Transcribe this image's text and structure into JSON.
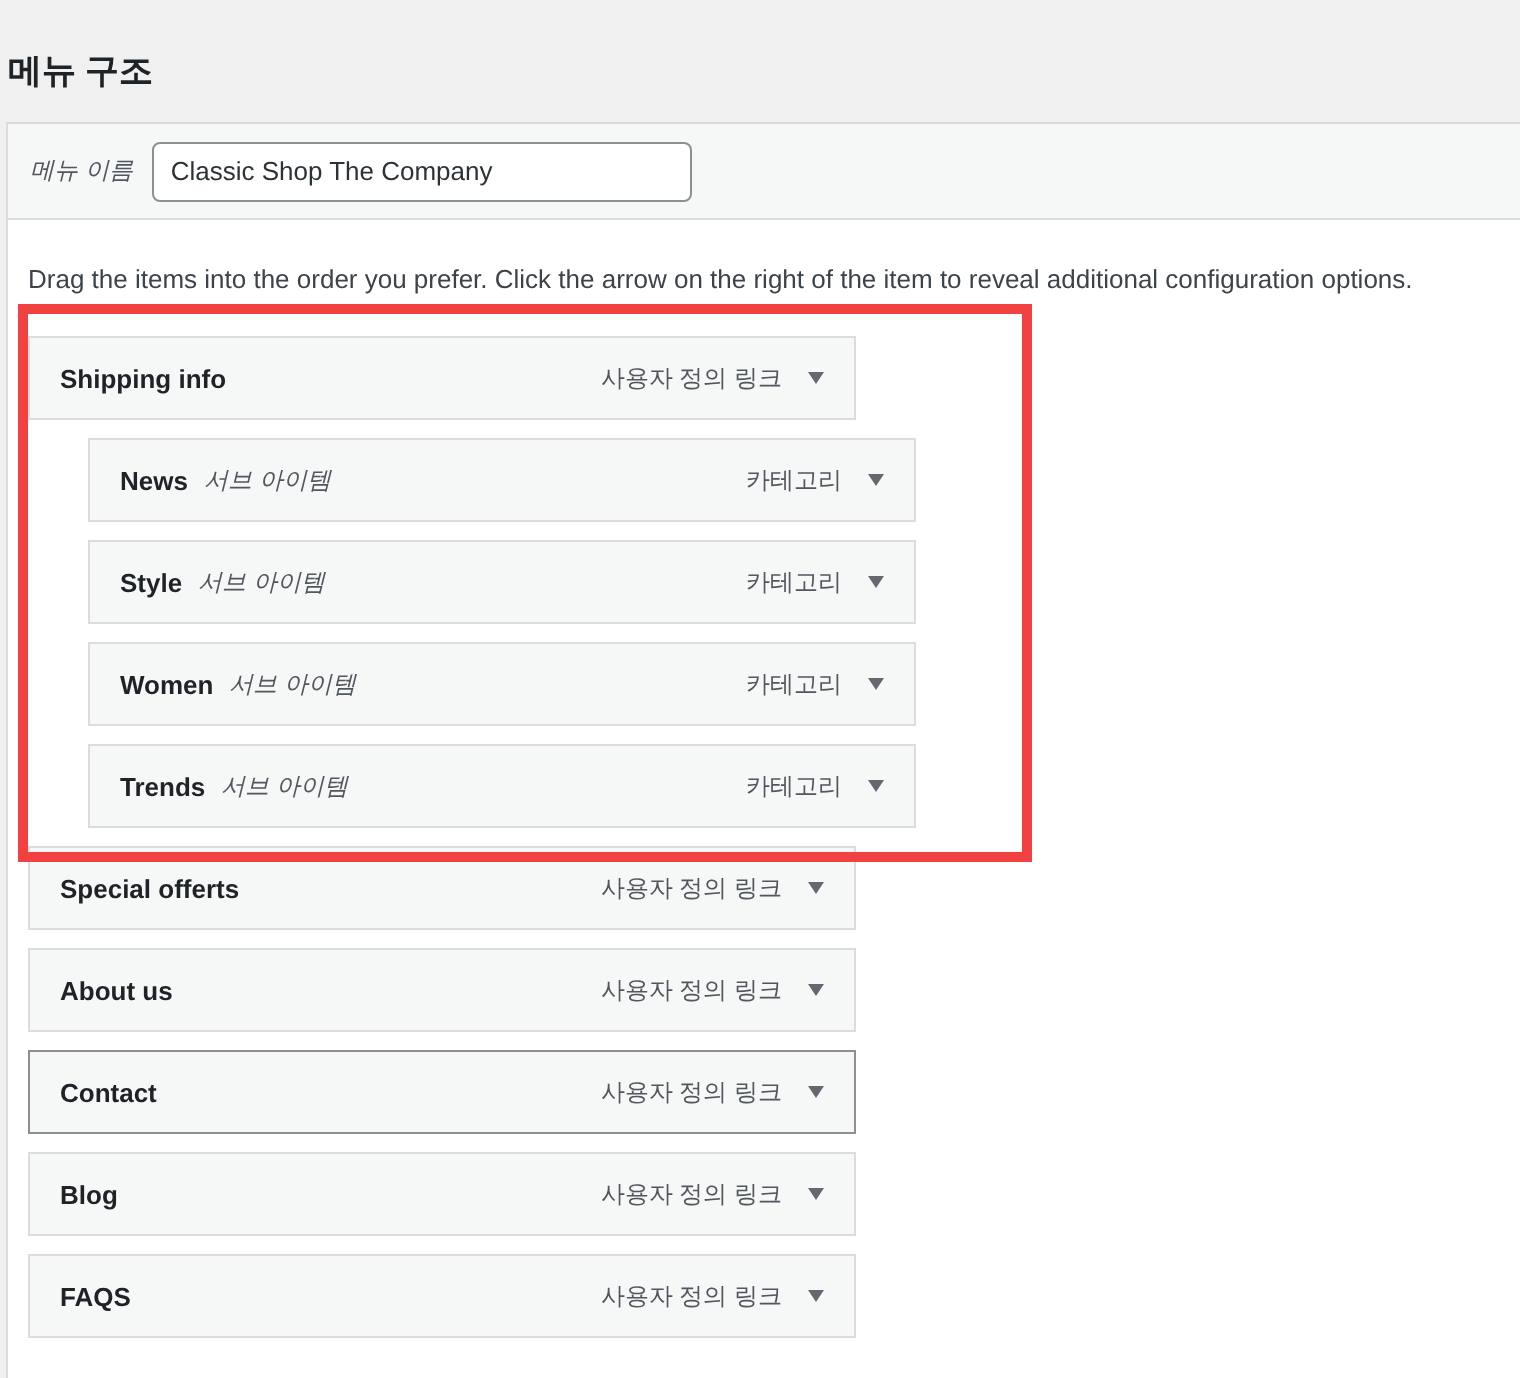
{
  "title": "메뉴 구조",
  "menu_name": {
    "label": "메뉴 이름",
    "value": "Classic Shop The Company"
  },
  "instructions": "Drag the items into the order you prefer. Click the arrow on the right of the item to reveal additional configuration options.",
  "items": [
    {
      "title": "Shipping info",
      "type": "사용자 정의 링크",
      "focused": false,
      "highlighted": true,
      "children": [
        {
          "title": "News",
          "sub_label": "서브 아이템",
          "type": "카테고리",
          "focused": false
        },
        {
          "title": "Style",
          "sub_label": "서브 아이템",
          "type": "카테고리",
          "focused": false
        },
        {
          "title": "Women",
          "sub_label": "서브 아이템",
          "type": "카테고리",
          "focused": false
        },
        {
          "title": "Trends",
          "sub_label": "서브 아이템",
          "type": "카테고리",
          "focused": false
        }
      ]
    },
    {
      "title": "Special offerts",
      "type": "사용자 정의 링크",
      "focused": false,
      "highlighted": false
    },
    {
      "title": "About us",
      "type": "사용자 정의 링크",
      "focused": false,
      "highlighted": false
    },
    {
      "title": "Contact",
      "type": "사용자 정의 링크",
      "focused": true,
      "highlighted": false
    },
    {
      "title": "Blog",
      "type": "사용자 정의 링크",
      "focused": false,
      "highlighted": false
    },
    {
      "title": "FAQS",
      "type": "사용자 정의 링크",
      "focused": false,
      "highlighted": false
    }
  ]
}
